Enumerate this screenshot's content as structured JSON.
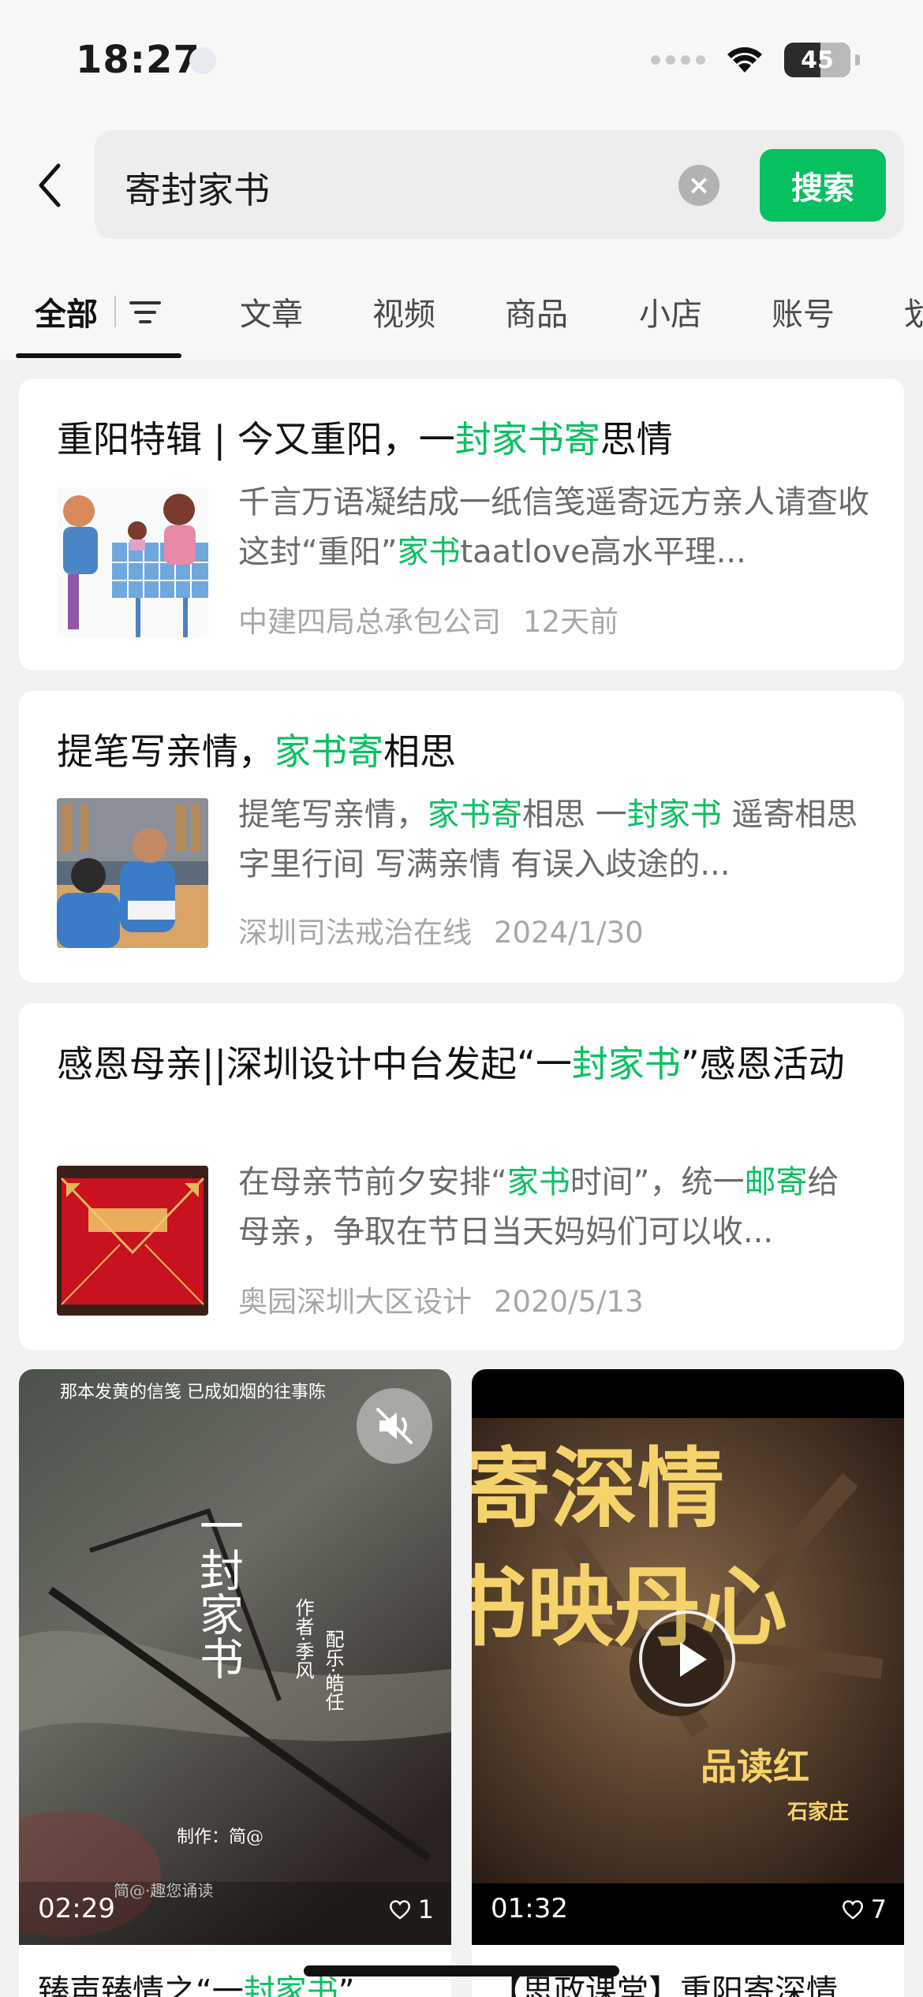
{
  "status": {
    "time": "18:27",
    "battery": "45"
  },
  "search": {
    "query": "寄封家书",
    "button_label": "搜索"
  },
  "tabs": [
    {
      "label": "全部"
    },
    {
      "label": "文章"
    },
    {
      "label": "视频"
    },
    {
      "label": "商品"
    },
    {
      "label": "小店"
    },
    {
      "label": "账号"
    },
    {
      "label": "划"
    }
  ],
  "articles": [
    {
      "title": [
        {
          "t": "重阳特辑 | 今又重阳，一"
        },
        {
          "t": "封家书寄",
          "hl": true
        },
        {
          "t": "思情"
        }
      ],
      "body": [
        {
          "t": "千言万语凝结成一纸信笺遥寄远方亲人请查收这封“重阳”"
        },
        {
          "t": "家书",
          "hl": true
        },
        {
          "t": "taatlove高水平理..."
        }
      ],
      "source": "中建四局总承包公司",
      "date": "12天前"
    },
    {
      "title": [
        {
          "t": "提笔写亲情，"
        },
        {
          "t": "家书寄",
          "hl": true
        },
        {
          "t": "相思"
        }
      ],
      "body": [
        {
          "t": "提笔写亲情，"
        },
        {
          "t": "家书寄",
          "hl": true
        },
        {
          "t": "相思 一"
        },
        {
          "t": "封家书",
          "hl": true
        },
        {
          "t": " 遥寄相思 字里行间 写满亲情 有误入歧途的..."
        }
      ],
      "source": "深圳司法戒治在线",
      "date": "2024/1/30"
    },
    {
      "title": [
        {
          "t": "感恩母亲||深圳设计中台发起“一"
        },
        {
          "t": "封家书",
          "hl": true
        },
        {
          "t": "”感恩活动"
        }
      ],
      "body": [
        {
          "t": "在母亲节前夕安排“"
        },
        {
          "t": "家书",
          "hl": true
        },
        {
          "t": "时间”，统一"
        },
        {
          "t": "邮寄",
          "hl": true
        },
        {
          "t": "给母亲，争取在节日当天妈妈们可以收..."
        }
      ],
      "source": "奥园深圳大区设计",
      "date": "2020/5/13"
    }
  ],
  "videos": [
    {
      "duration": "02:29",
      "likes": "1",
      "overlay_top": "那本发黄的信笺 已成如烟的往事陈",
      "overlay_title": "一封家书",
      "overlay_credit_author": "作者·季风",
      "overlay_credit_music": "配乐·皓任",
      "overlay_producer": "制作：简@",
      "overlay_footer": "简@·趣您诵读",
      "caption_pre": "臻声臻情之“一",
      "caption_hl": "封家书",
      "caption_post": "”"
    },
    {
      "duration": "01:32",
      "likes": "7",
      "overlay_line1": "寄深情",
      "overlay_line2": "书映丹心",
      "overlay_sub": "品读红",
      "overlay_sub2": "石家庄",
      "caption": "【思政课堂】重阳寄深情"
    }
  ]
}
